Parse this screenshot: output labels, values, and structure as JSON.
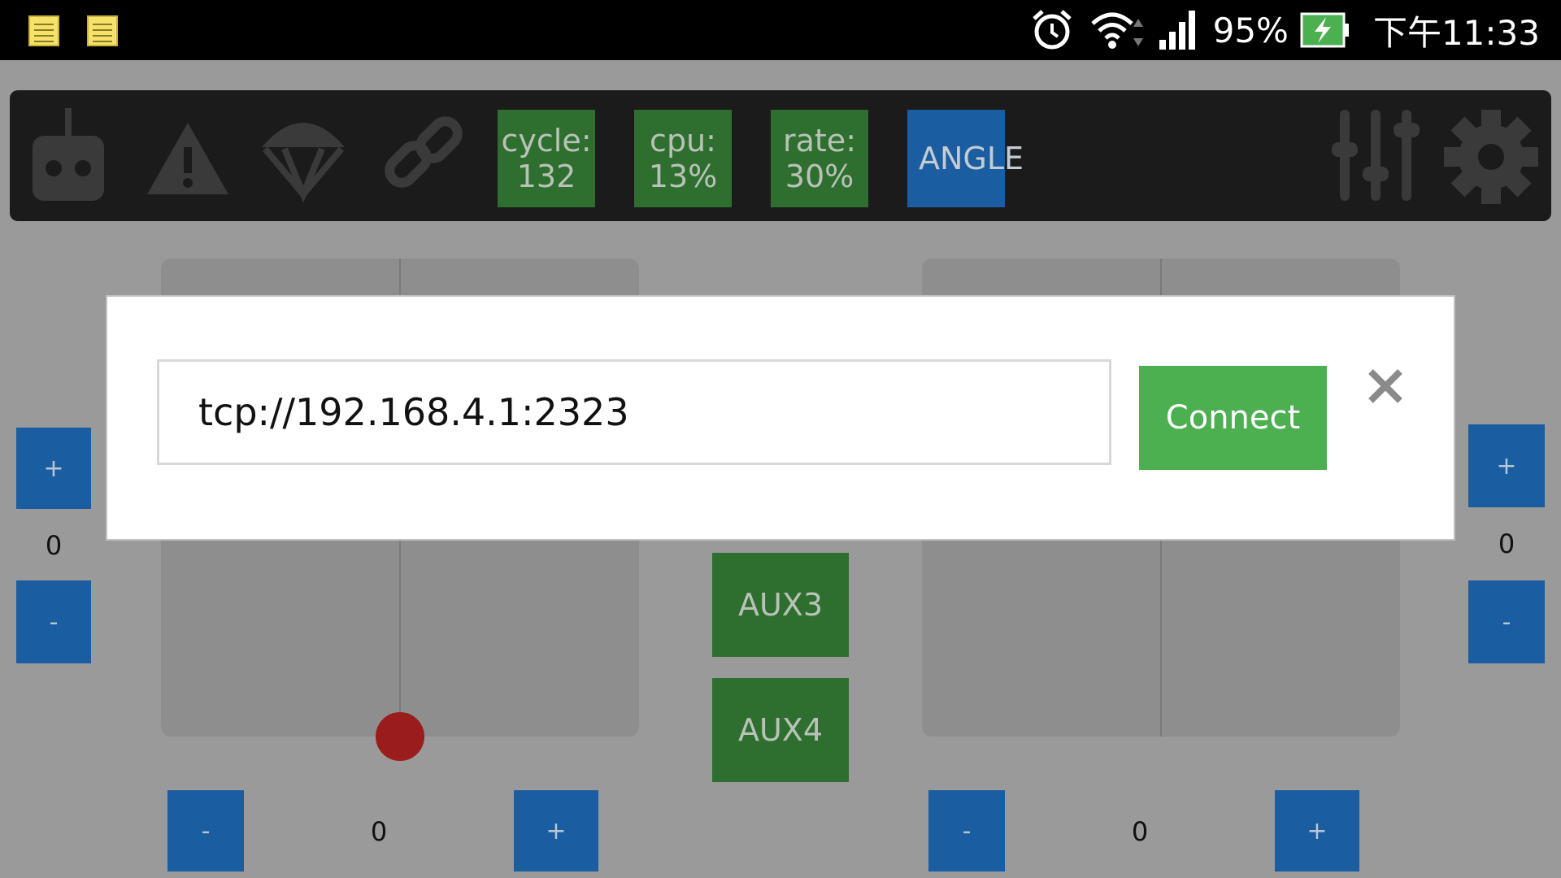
{
  "status_bar": {
    "battery_percent": "95%",
    "time": "下午11:33",
    "icons": [
      "notes-icon",
      "notes-icon",
      "alarm-icon",
      "wifi-icon",
      "signal-icon",
      "battery-charging-icon"
    ]
  },
  "toolbar": {
    "icons": [
      "remote-controller-icon",
      "warning-icon",
      "parachute-icon",
      "link-icon",
      "sliders-icon",
      "gear-icon"
    ],
    "stats": [
      {
        "label": "cycle:",
        "value": "132"
      },
      {
        "label": "cpu:",
        "value": "13%"
      },
      {
        "label": "rate:",
        "value": "30%"
      }
    ],
    "mode": "ANGLE"
  },
  "controls": {
    "left_trim_value": "0",
    "right_trim_value": "0",
    "bottom_left_value": "0",
    "bottom_right_value": "0",
    "plus": "+",
    "minus": "-",
    "aux3": "AUX3",
    "aux4": "AUX4"
  },
  "dialog": {
    "url_value": "tcp://192.168.4.1:2323",
    "connect_label": "Connect"
  },
  "colors": {
    "stat_green": "#2e6e2e",
    "mode_blue": "#1a5ea1",
    "connect_green": "#4caf50",
    "knob_red": "#9b1c1c"
  }
}
